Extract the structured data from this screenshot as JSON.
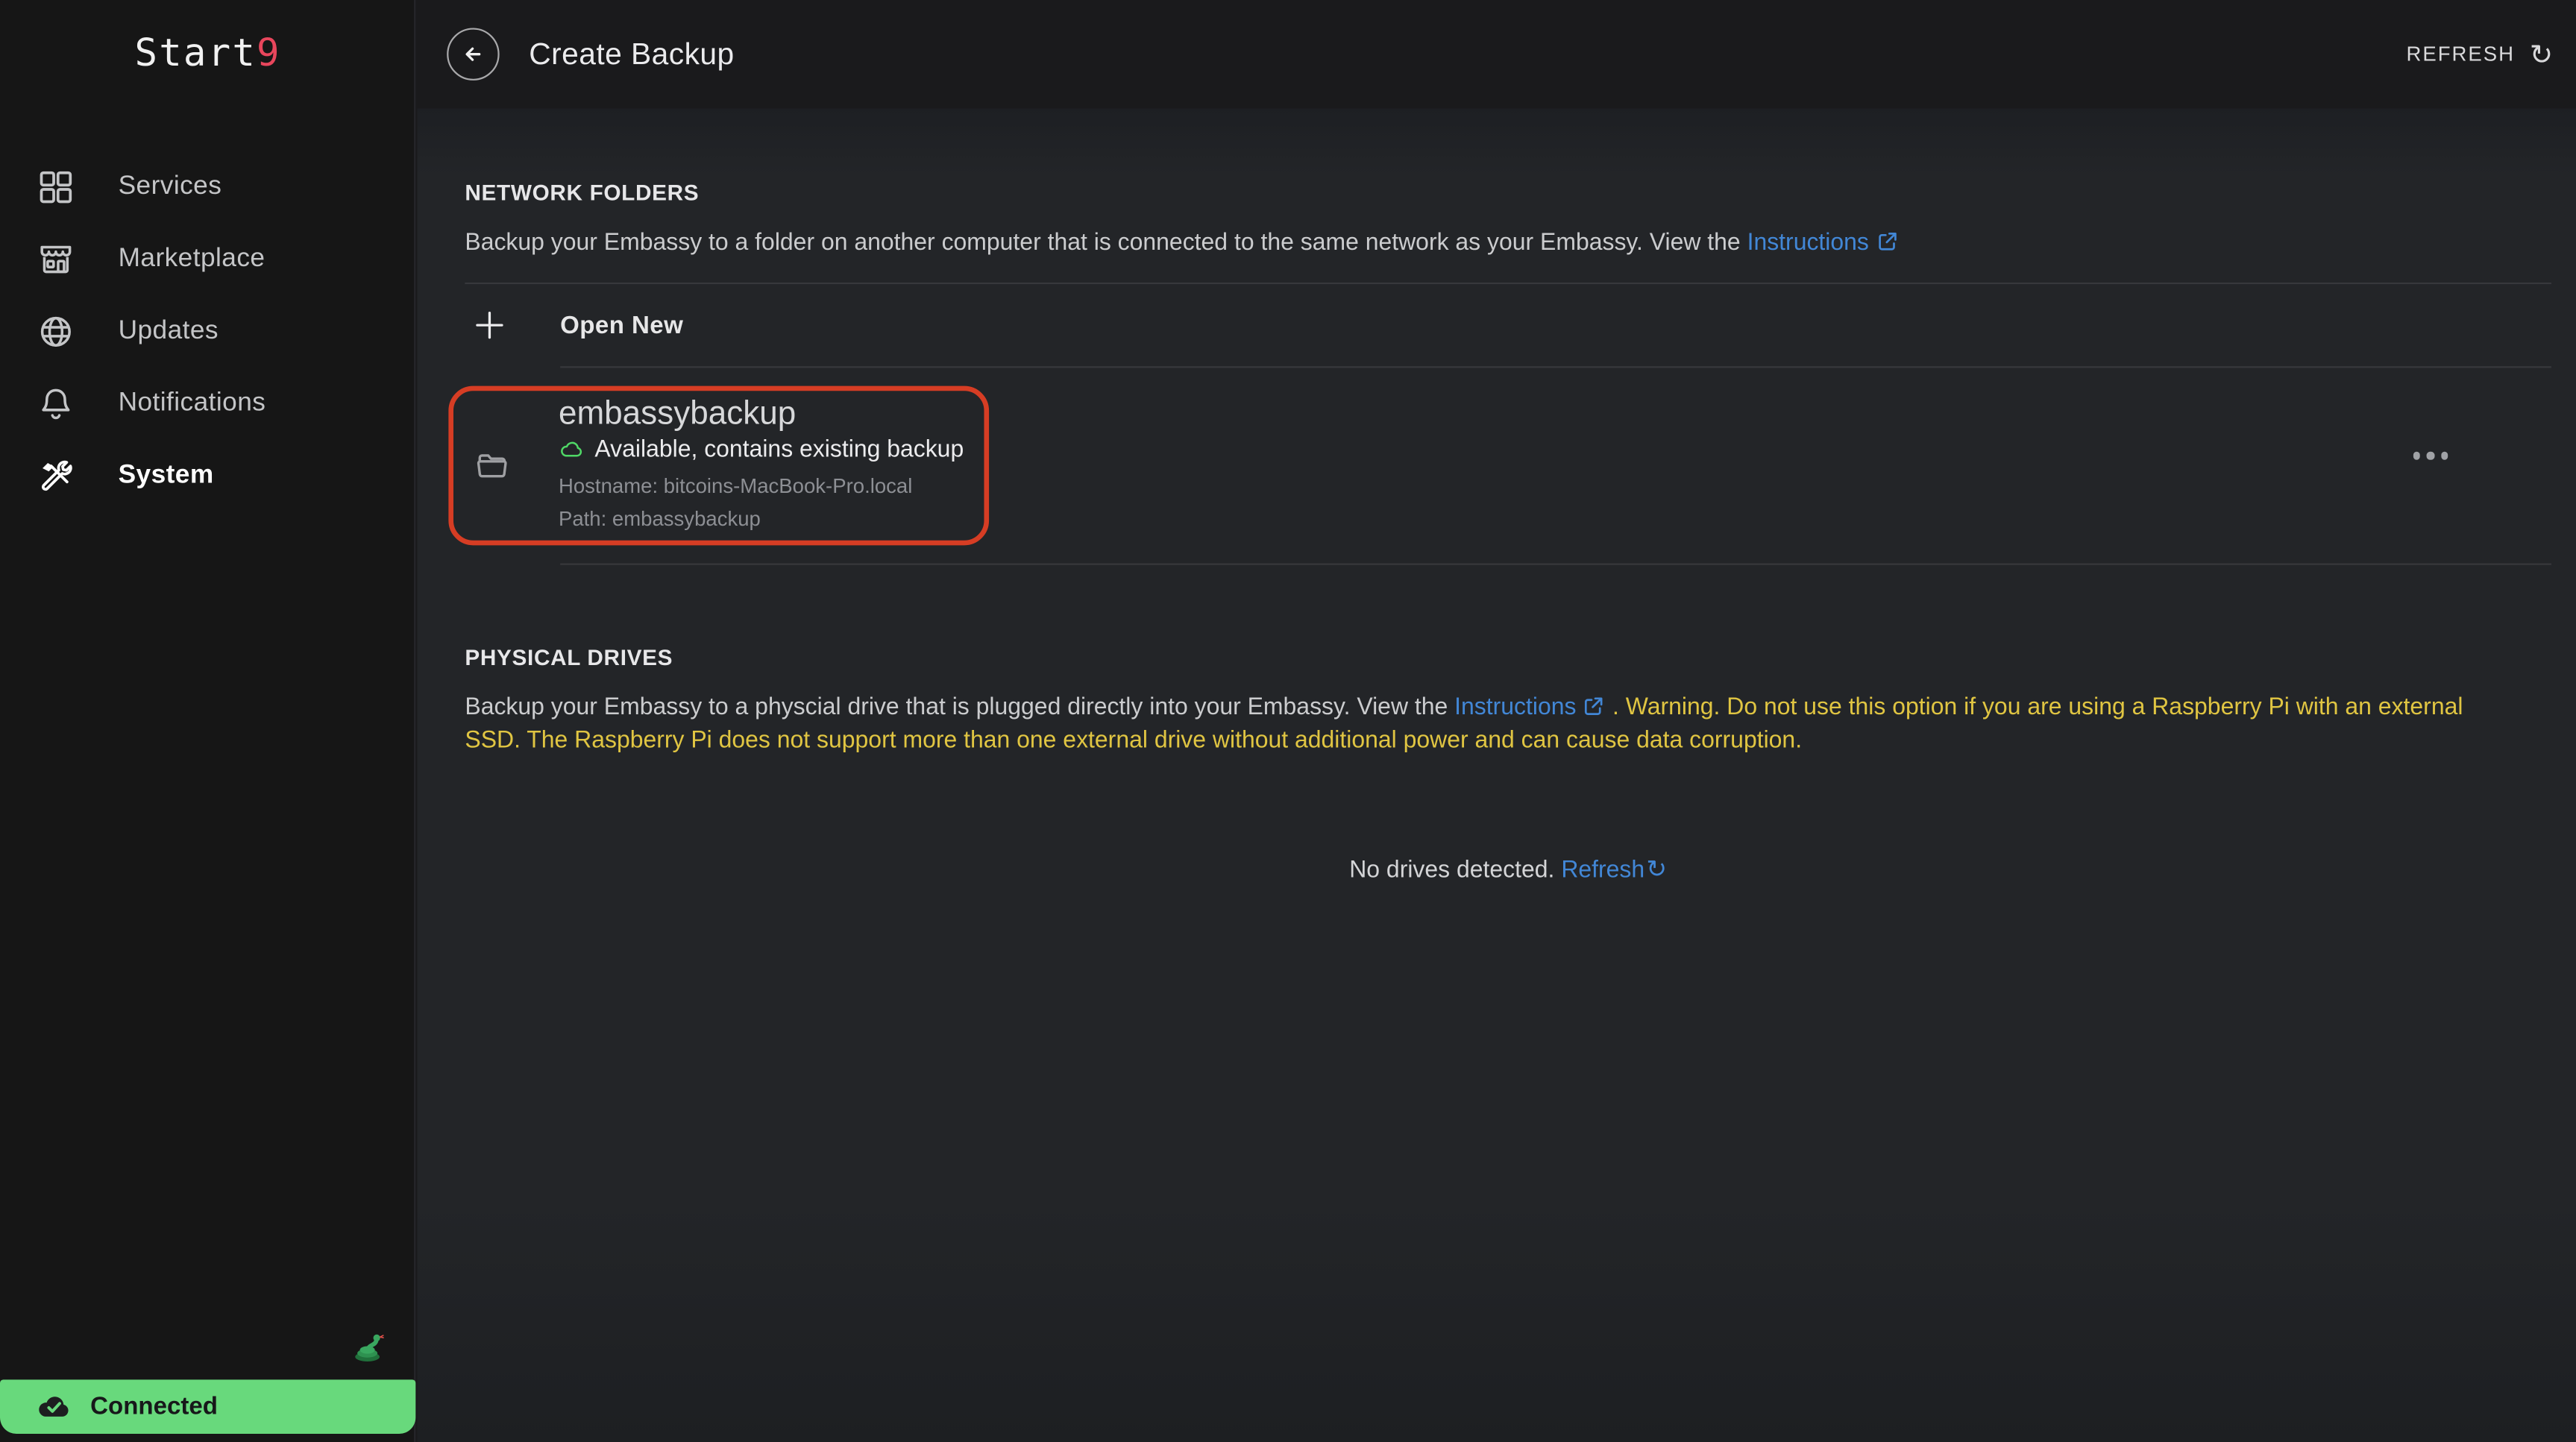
{
  "brand": {
    "name_prefix": "Start",
    "name_accent": "9"
  },
  "sidebar": {
    "items": [
      {
        "label": "Services"
      },
      {
        "label": "Marketplace"
      },
      {
        "label": "Updates"
      },
      {
        "label": "Notifications"
      },
      {
        "label": "System"
      }
    ],
    "connection_status": "Connected"
  },
  "header": {
    "title": "Create Backup",
    "refresh_label": "REFRESH",
    "refresh_glyph": "↻"
  },
  "network_folders": {
    "heading": "NETWORK FOLDERS",
    "description": "Backup your Embassy to a folder on another computer that is connected to the same network as your Embassy. View the ",
    "instructions_label": "Instructions",
    "open_new_label": "Open New",
    "folder": {
      "name": "embassybackup",
      "status": "Available, contains existing backup",
      "hostname": "Hostname: bitcoins-MacBook-Pro.local",
      "path": "Path: embassybackup"
    }
  },
  "physical_drives": {
    "heading": "PHYSICAL DRIVES",
    "description": "Backup your Embassy to a physcial drive that is plugged directly into your Embassy. View the ",
    "instructions_label": "Instructions",
    "warning": " . Warning. Do not use this option if you are using a Raspberry Pi with an external SSD. The Raspberry Pi does not support more than one external drive without additional power and can cause data corruption.",
    "empty_message": "No drives detected. ",
    "refresh_link_label": "Refresh",
    "refresh_glyph": "↻"
  },
  "colors": {
    "highlight_red": "#d63d24",
    "link_blue": "#4287d6",
    "warning_yellow": "#e0c542",
    "success_green": "#68d97c",
    "logo_accent_red": "#e8465c"
  }
}
